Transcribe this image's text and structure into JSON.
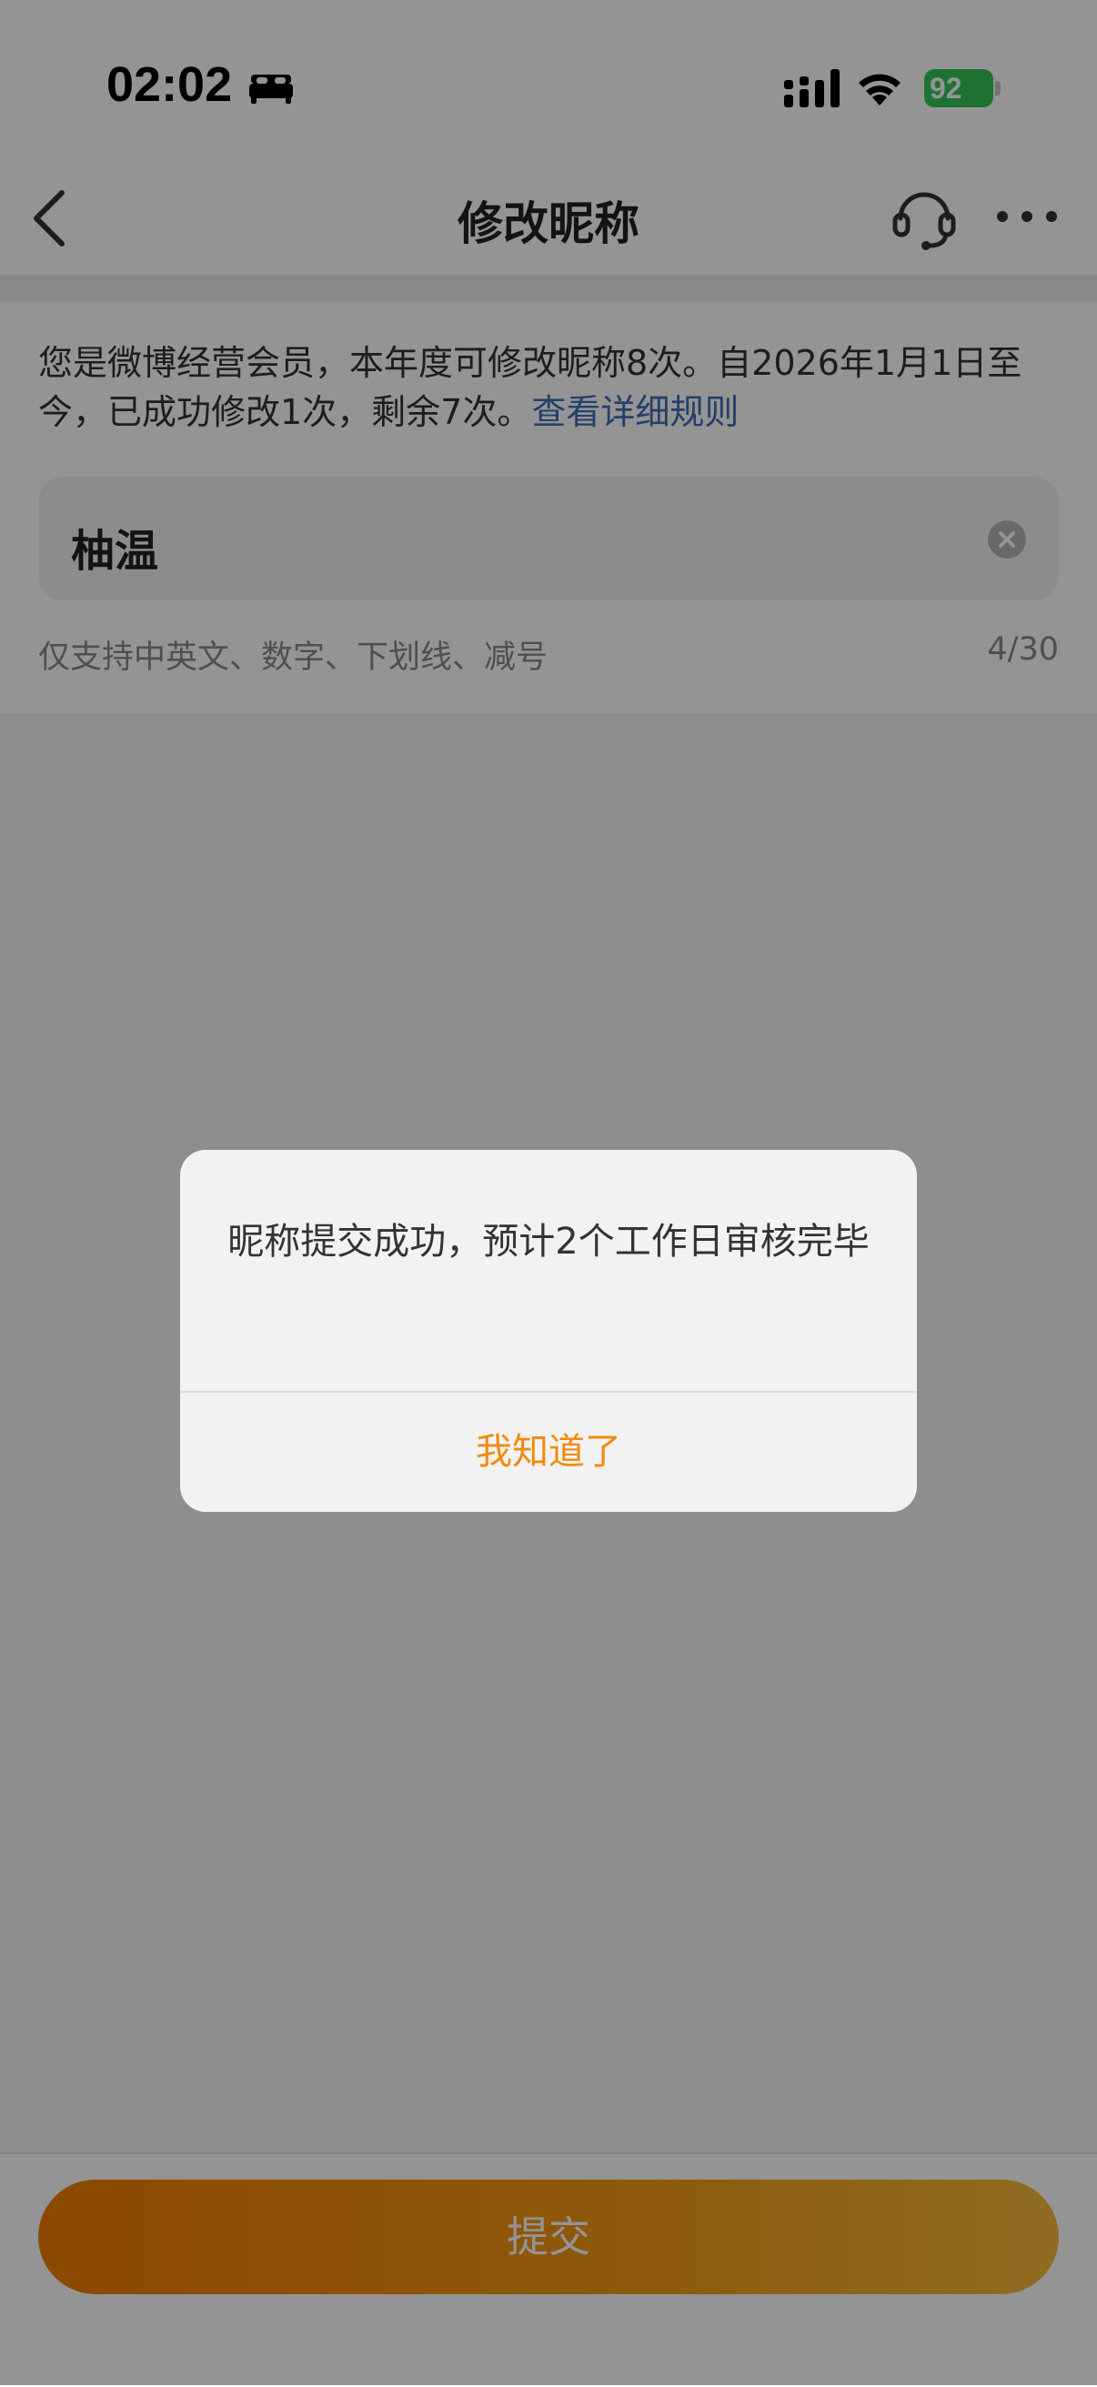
{
  "status_bar": {
    "time": "02:02",
    "battery_level": "92",
    "battery_color": "#34c759"
  },
  "nav": {
    "title": "修改昵称",
    "back_icon": "chevron-left-icon",
    "service_icon": "headset-icon",
    "more_icon": "more-dots-icon"
  },
  "notice": {
    "text": "您是微博经营会员，本年度可修改昵称8次。自2026年1月1日至今，已成功修改1次，剩余7次。",
    "link": "查看详细规则",
    "link_color": "#3d6fb5"
  },
  "nickname": {
    "value": "柚温",
    "hint": "仅支持中英文、数字、下划线、减号",
    "count": "4/30"
  },
  "submit": {
    "label": "提交",
    "gradient": [
      "#f27d00",
      "#f59c16",
      "#f6bb3b"
    ]
  },
  "dialog": {
    "message": "昵称提交成功，预计2个工作日审核完毕",
    "confirm_label": "我知道了",
    "confirm_color": "#f28a0c"
  }
}
